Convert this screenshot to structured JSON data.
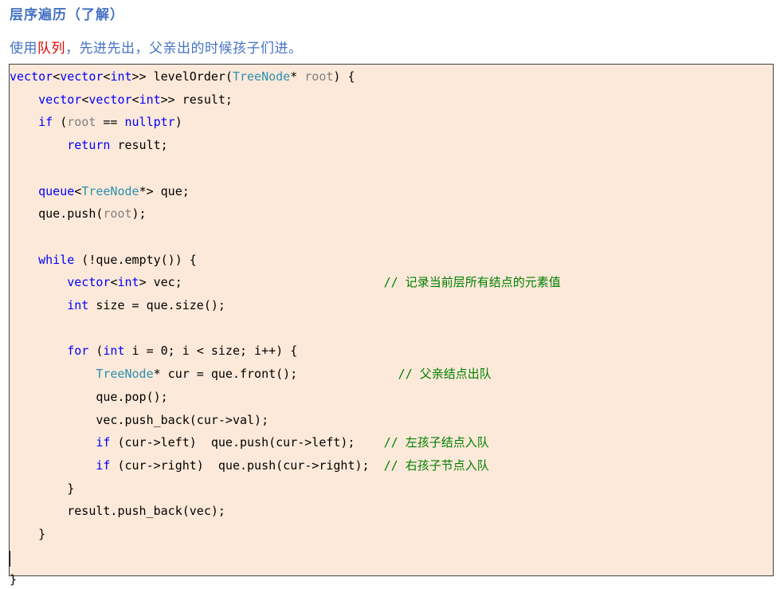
{
  "heading": "层序遍历（了解）",
  "intro": {
    "prefix": "使用",
    "highlight": "队列",
    "suffix": "，先进先出，父亲出的时候孩子们进。",
    "highlight_color": "#e60000"
  },
  "code": {
    "background": "#fde9d9",
    "keyword_color": "#0000ff",
    "type_color": "#2b91af",
    "comment_color": "#008000",
    "lines": [
      [
        [
          "kw",
          "vector"
        ],
        [
          "",
          "<"
        ],
        [
          "kw",
          "vector"
        ],
        [
          "",
          "<"
        ],
        [
          "kw",
          "int"
        ],
        [
          "",
          ">> levelOrder("
        ],
        [
          "ty",
          "TreeNode"
        ],
        [
          "",
          "* "
        ],
        [
          "pm",
          "root"
        ],
        [
          "",
          ") {"
        ]
      ],
      [
        [
          "",
          "    "
        ],
        [
          "kw",
          "vector"
        ],
        [
          "",
          "<"
        ],
        [
          "kw",
          "vector"
        ],
        [
          "",
          "<"
        ],
        [
          "kw",
          "int"
        ],
        [
          "",
          ">> result;"
        ]
      ],
      [
        [
          "",
          "    "
        ],
        [
          "kw",
          "if"
        ],
        [
          "",
          " ("
        ],
        [
          "pm",
          "root"
        ],
        [
          "",
          " == "
        ],
        [
          "kw",
          "nullptr"
        ],
        [
          "",
          ")"
        ]
      ],
      [
        [
          "",
          "        "
        ],
        [
          "kw",
          "return"
        ],
        [
          "",
          " result;"
        ]
      ],
      [],
      [
        [
          "",
          "    "
        ],
        [
          "kw",
          "queue"
        ],
        [
          "",
          "<"
        ],
        [
          "ty",
          "TreeNode"
        ],
        [
          "",
          "*> que;"
        ]
      ],
      [
        [
          "",
          "    que.push("
        ],
        [
          "pm",
          "root"
        ],
        [
          "",
          ");"
        ]
      ],
      [],
      [
        [
          "",
          "    "
        ],
        [
          "kw",
          "while"
        ],
        [
          "",
          " (!que.empty()) {"
        ]
      ],
      [
        [
          "",
          "        "
        ],
        [
          "kw",
          "vector"
        ],
        [
          "",
          "<"
        ],
        [
          "kw",
          "int"
        ],
        [
          "",
          "> vec;                            "
        ],
        [
          "cm",
          "// 记录当前层所有结点的元素值"
        ]
      ],
      [
        [
          "",
          "        "
        ],
        [
          "kw",
          "int"
        ],
        [
          "",
          " size = que.size();"
        ]
      ],
      [],
      [
        [
          "",
          "        "
        ],
        [
          "kw",
          "for"
        ],
        [
          "",
          " ("
        ],
        [
          "kw",
          "int"
        ],
        [
          "",
          " i = 0; i < size; i++) {"
        ]
      ],
      [
        [
          "",
          "            "
        ],
        [
          "ty",
          "TreeNode"
        ],
        [
          "",
          "* cur = que.front();              "
        ],
        [
          "cm",
          "// 父亲结点出队"
        ]
      ],
      [
        [
          "",
          "            que.pop();"
        ]
      ],
      [
        [
          "",
          "            vec.push_back(cur->val);"
        ]
      ],
      [
        [
          "",
          "            "
        ],
        [
          "kw",
          "if"
        ],
        [
          "",
          " (cur->left)  que.push(cur->left);    "
        ],
        [
          "cm",
          "// 左孩子结点入队"
        ]
      ],
      [
        [
          "",
          "            "
        ],
        [
          "kw",
          "if"
        ],
        [
          "",
          " (cur->right)  que.push(cur->right);  "
        ],
        [
          "cm",
          "// 右孩子节点入队"
        ]
      ],
      [
        [
          "",
          "        }"
        ]
      ],
      [
        [
          "",
          "        result.push_back(vec);"
        ]
      ],
      [
        [
          "",
          "    }"
        ]
      ],
      [],
      [
        [
          "",
          "}"
        ]
      ]
    ]
  }
}
